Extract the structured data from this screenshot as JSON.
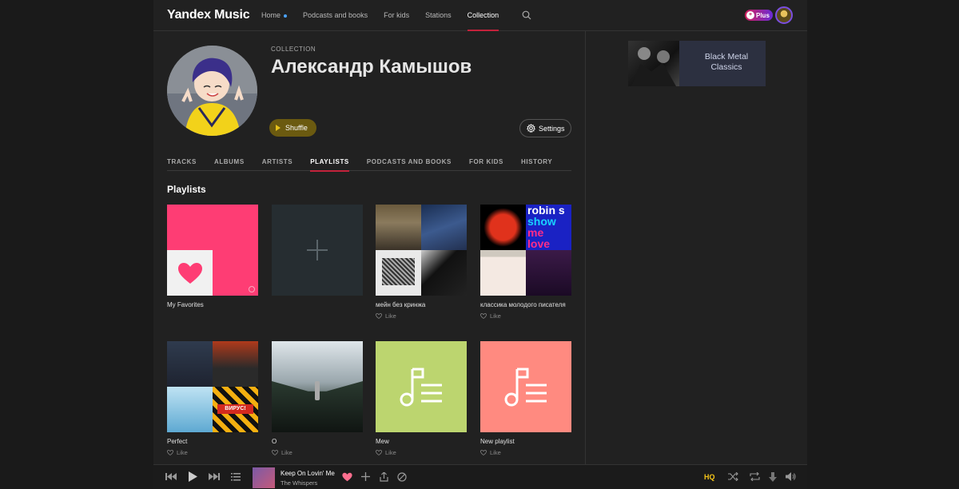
{
  "header": {
    "logo": "Yandex Music",
    "nav": [
      {
        "label": "Home"
      },
      {
        "label": "Podcasts and books"
      },
      {
        "label": "For kids"
      },
      {
        "label": "Stations"
      },
      {
        "label": "Collection"
      }
    ],
    "plus_label": "Plus"
  },
  "ad": {
    "title": "Black Metal Classics"
  },
  "profile": {
    "collection_label": "COLLECTION",
    "name": "Александр Камышов",
    "shuffle_label": "Shuffle",
    "settings_label": "Settings"
  },
  "tabs": [
    {
      "label": "TRACKS"
    },
    {
      "label": "ALBUMS"
    },
    {
      "label": "ARTISTS"
    },
    {
      "label": "PLAYLISTS"
    },
    {
      "label": "PODCASTS AND BOOKS"
    },
    {
      "label": "FOR KIDS"
    },
    {
      "label": "HISTORY"
    }
  ],
  "active_tab": "PLAYLISTS",
  "section_title": "Playlists",
  "playlists": [
    {
      "title": "My Favorites",
      "like": ""
    },
    {
      "title": "",
      "like": ""
    },
    {
      "title": "мейн без кринжа",
      "like": "Like"
    },
    {
      "title": "классика молодого писателя",
      "like": "Like"
    },
    {
      "title": "Perfect",
      "like": "Like"
    },
    {
      "title": "O",
      "like": "Like"
    },
    {
      "title": "Mew",
      "like": "Like"
    },
    {
      "title": "New playlist",
      "like": "Like"
    }
  ],
  "cover_text": {
    "robin_line1": "robin s",
    "robin_line2": "show",
    "robin_line3": "me",
    "robin_line4": "love"
  },
  "player": {
    "track_title": "Keep On Lovin' Me",
    "track_artist": "The Whispers",
    "quality": "HQ"
  },
  "colors": {
    "accent_red": "#c3223b",
    "favorites_pink": "#fe3d74",
    "shuffle_gold": "#6b5a10",
    "hq_yellow": "#f5c518",
    "mew_green": "#bcd56f",
    "new_salmon": "#ff8a80"
  }
}
